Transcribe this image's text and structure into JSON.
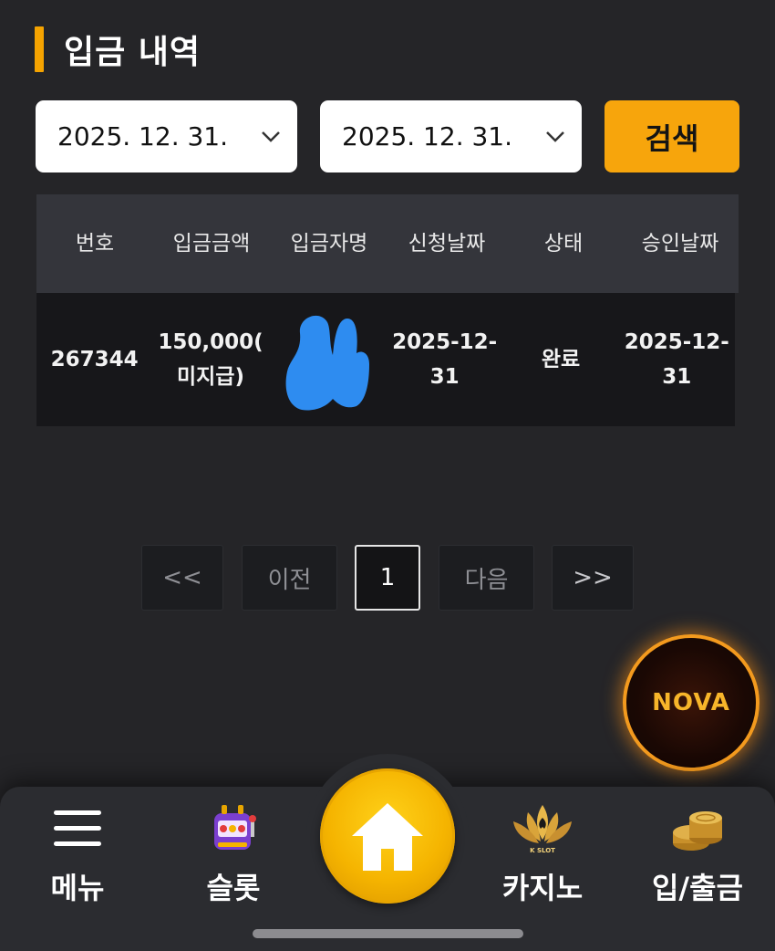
{
  "page": {
    "title": "입금 내역"
  },
  "filters": {
    "start_date": "2025. 12. 31.",
    "end_date": "2025. 12. 31.",
    "search_label": "검색"
  },
  "table": {
    "headers": [
      "번호",
      "입금금액",
      "입금자명",
      "신청날짜",
      "상태",
      "승인날짜"
    ],
    "rows": [
      {
        "no": "267344",
        "amount_line1": "150,000(",
        "amount_line2": "미지급)",
        "depositor": "",
        "request_date_line1": "2025-12-",
        "request_date_line2": "31",
        "status": "완료",
        "approve_date_line1": "2025-12-",
        "approve_date_line2": "31"
      }
    ]
  },
  "pagination": {
    "first": "<<",
    "prev": "이전",
    "current": "1",
    "next": "다음",
    "last": ">>"
  },
  "floating_badge": {
    "text": "NOVA"
  },
  "bottom_nav": {
    "menu": "메뉴",
    "slot": "슬롯",
    "casino": "카지노",
    "bank": "입/출금",
    "casino_logo_text": "K SLOT"
  },
  "colors": {
    "accent": "#f5a300",
    "background": "#252528",
    "table_header": "#34353b",
    "table_row": "#17171a",
    "redaction_blue": "#2e8cf0"
  }
}
